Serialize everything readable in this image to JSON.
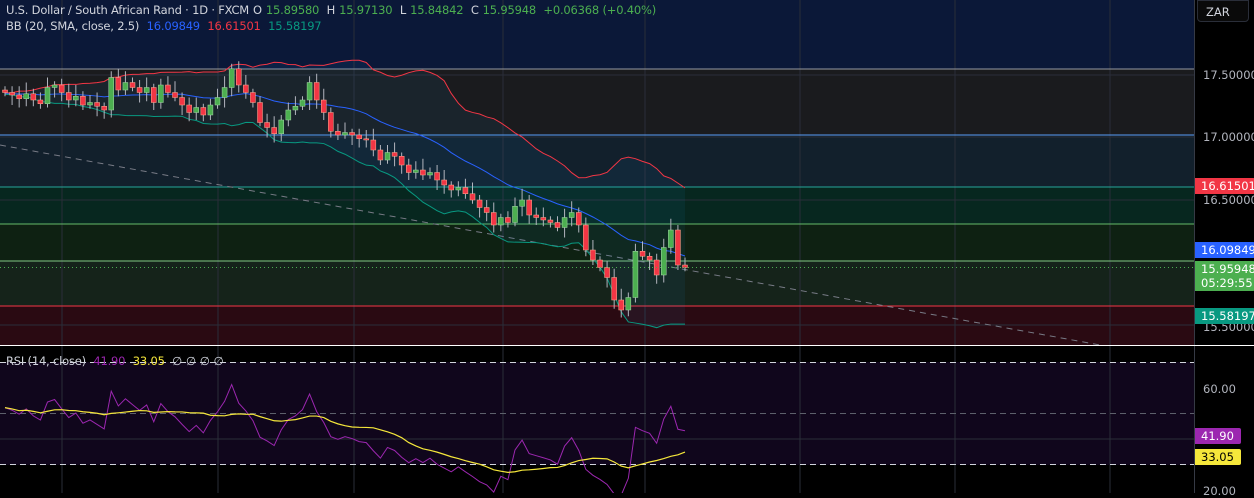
{
  "header": {
    "symbol": "U.S. Dollar / South African Rand · 1D · FXCM",
    "o_label": "O",
    "o": "15.89580",
    "h_label": "H",
    "h": "15.97130",
    "l_label": "L",
    "l": "15.84842",
    "c_label": "C",
    "c": "15.95948",
    "change": "+0.06368 (+0.40%)"
  },
  "bb": {
    "label": "BB (20, SMA, close, 2.5)",
    "basis": "16.09849",
    "upper": "16.61501",
    "lower": "15.58197"
  },
  "rsi": {
    "label": "RSI (14, close)",
    "value": "41.90",
    "ma": "33.05",
    "extra": [
      "∅",
      "∅",
      "∅",
      "∅"
    ]
  },
  "axis": {
    "currency": "ZAR",
    "price_ticks": [
      "17.50000",
      "17.00000",
      "16.50000",
      "15.50000"
    ],
    "rsi_ticks": [
      "60.00",
      "20.00"
    ],
    "countdown": "05:29:55"
  },
  "colors": {
    "up": "#4caf50",
    "down": "#f23645",
    "basis": "#2962ff",
    "upper": "#f23645",
    "lower": "#089981",
    "rsi": "#9c27b0",
    "rsi_ma": "#f5e73b"
  },
  "chart_data": {
    "type": "candlestick",
    "closes": [
      17.36,
      17.34,
      17.31,
      17.35,
      17.3,
      17.27,
      17.4,
      17.42,
      17.36,
      17.3,
      17.33,
      17.26,
      17.28,
      17.25,
      17.22,
      17.48,
      17.38,
      17.44,
      17.4,
      17.36,
      17.4,
      17.28,
      17.42,
      17.36,
      17.32,
      17.26,
      17.2,
      17.24,
      17.18,
      17.26,
      17.32,
      17.4,
      17.55,
      17.42,
      17.36,
      17.28,
      17.12,
      17.08,
      17.03,
      17.14,
      17.22,
      17.25,
      17.3,
      17.44,
      17.3,
      17.2,
      17.05,
      17.02,
      17.04,
      17.02,
      16.99,
      16.98,
      16.9,
      16.82,
      16.88,
      16.85,
      16.78,
      16.72,
      16.74,
      16.7,
      16.72,
      16.66,
      16.62,
      16.58,
      16.6,
      16.55,
      16.5,
      16.44,
      16.4,
      16.3,
      16.36,
      16.32,
      16.45,
      16.5,
      16.38,
      16.36,
      16.34,
      16.32,
      16.28,
      16.36,
      16.4,
      16.3,
      16.1,
      16.02,
      15.96,
      15.88,
      15.7,
      15.62,
      15.72,
      16.09,
      16.05,
      16.02,
      15.9,
      16.12,
      16.26,
      15.98,
      15.96
    ],
    "levels": [
      17.55,
      17.02,
      16.6,
      16.3,
      16.0,
      15.65
    ],
    "ylim": [
      15.35,
      18.1
    ],
    "rsi_levels": [
      70,
      50,
      30
    ]
  }
}
